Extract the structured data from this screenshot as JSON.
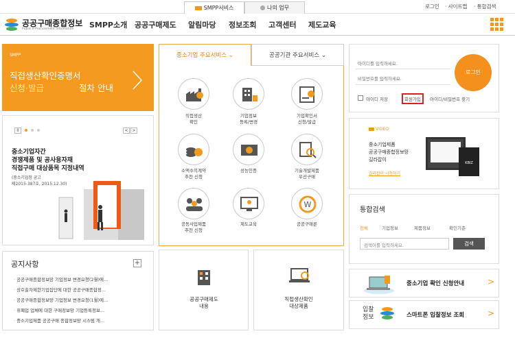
{
  "topbar": {
    "tab_smpp": "SMPP서비스",
    "tab_mywork": "나의 업무",
    "login": "로그인",
    "sitemap": "사이트맵",
    "unified_search": "통합검색"
  },
  "header": {
    "logo_title": "공공구매종합정보",
    "logo_sub": "Public e-Procurement information",
    "nav": [
      "SMPP소개",
      "공공구매제도",
      "알림마당",
      "정보조회",
      "고객센터",
      "제도교육"
    ]
  },
  "banner": {
    "small": "SMPP",
    "line1": "직접생산확인증명서",
    "line2_highlight": "신청·발급",
    "line2_rest": "절차 안내"
  },
  "slide": {
    "title_lines": [
      "중소기업자간",
      "경쟁제품 및 공사용자재",
      "직접구매 대상품목 지정내역"
    ],
    "sub_lines": [
      "(중소기업청 공고",
      "제2015-387호, 2015.12.30)"
    ],
    "pause": "II",
    "prev": "<",
    "next": ">"
  },
  "notice": {
    "title": "공지사항",
    "plus": "+",
    "items": [
      "공공구매종합정보망 기업정보 변경요청(2월)에...",
      "상호출자제한기업집단에 대한 공공구매종합정...",
      "공공구매종합정보망 기업정보 변경요청(1월)에...",
      "휴폐업 업체에 대한 구매정보망 기업등록정보...",
      "중소기업제품 공공구매 종합정보망 시스템 개..."
    ]
  },
  "services": {
    "tab_active": "중소기업 주요서비스",
    "tab_other": "공공기관 주요서비스",
    "items": [
      {
        "l1": "직접생산",
        "l2": "확인",
        "icon": "factory-icon"
      },
      {
        "l1": "기업정보",
        "l2": "등록/변경",
        "icon": "building-edit-icon"
      },
      {
        "l1": "기업확인서",
        "l2": "신청/발급",
        "icon": "certificate-icon"
      },
      {
        "l1": "소액수의계약",
        "l2": "추천 신청",
        "icon": "coins-icon"
      },
      {
        "l1": "성능인증",
        "l2": "",
        "icon": "performance-icon"
      },
      {
        "l1": "기술개발제품",
        "l2": "우선구매",
        "icon": "search-doc-icon"
      },
      {
        "l1": "공동사업제품",
        "l2": "추천 신청",
        "icon": "group-icon"
      },
      {
        "l1": "제도교육",
        "l2": "",
        "icon": "education-icon"
      },
      {
        "l1": "공공구매론",
        "l2": "",
        "icon": "won-cycle-icon"
      }
    ]
  },
  "bottom_boxes": [
    {
      "l1": "공공구매제도",
      "l2": "내용"
    },
    {
      "l1": "직접생산확인",
      "l2": "대상제품"
    }
  ],
  "login": {
    "id_placeholder": "아이디를 입력하세요.",
    "pw_placeholder": "비밀번호를 입력하세요.",
    "button": "로그인",
    "save_id": "아이디 저장",
    "join": "회원가입",
    "find": "아이디/비밀번호 찾기"
  },
  "video": {
    "tag": "VIDEO",
    "lines": [
      "중소기업제품",
      "공공구매종합정보망",
      "길라잡이"
    ],
    "link": "길라잡이 시청하기",
    "screen_logo": "KBIZ"
  },
  "search": {
    "title": "통합검색",
    "tabs": [
      "전체",
      "기업정보",
      "제품정보",
      "확인기준"
    ],
    "placeholder": "검색어를 입력하세요.",
    "button": "검색"
  },
  "links": {
    "check": "중소기업 확인 신청안내",
    "bid_logo_l1": "입찰",
    "bid_logo_l2": "정보",
    "bid": "스마트폰 입찰정보 조회",
    "chevron": ">"
  },
  "colors": {
    "accent": "#f39a1e",
    "highlight_box": "#e0201b"
  }
}
